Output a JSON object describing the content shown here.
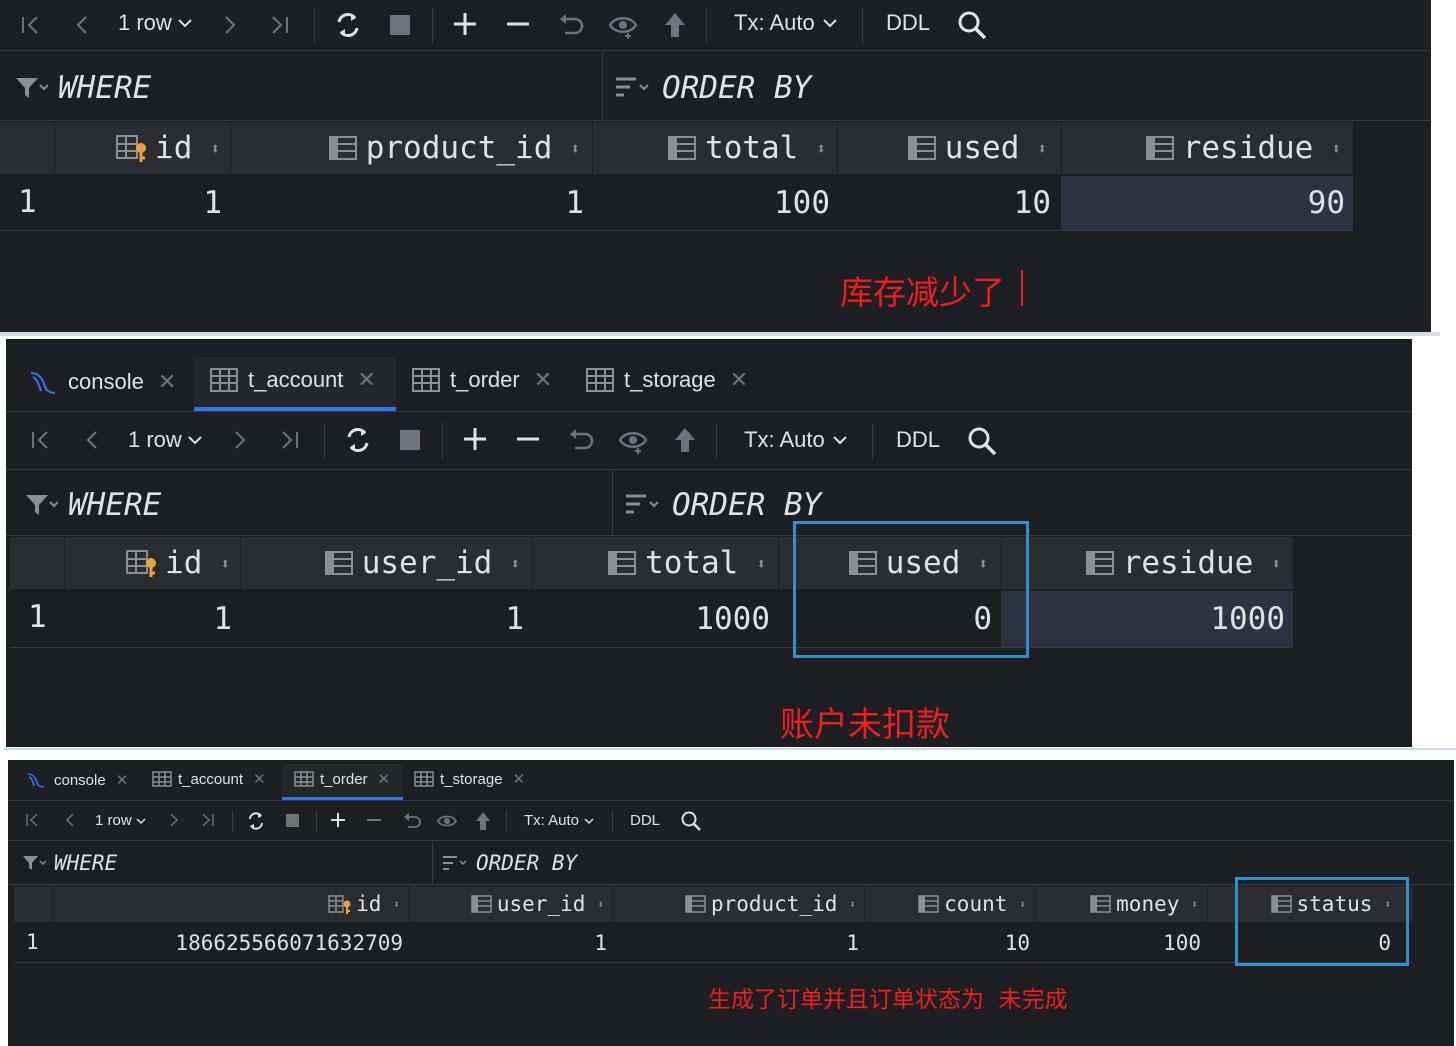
{
  "toolbar": {
    "row_count": "1 row",
    "tx": "Tx: Auto",
    "ddl": "DDL"
  },
  "filters": {
    "where": "WHERE",
    "order_by": "ORDER BY"
  },
  "tabs": [
    {
      "label": "console",
      "active": false
    },
    {
      "label": "t_account",
      "active": true
    },
    {
      "label": "t_order",
      "active": false
    },
    {
      "label": "t_storage",
      "active": false
    }
  ],
  "tabs3": [
    {
      "label": "console",
      "active": false
    },
    {
      "label": "t_account",
      "active": false
    },
    {
      "label": "t_order",
      "active": true
    },
    {
      "label": "t_storage",
      "active": false
    }
  ],
  "storage": {
    "columns": [
      "id",
      "product_id",
      "total",
      "used",
      "residue"
    ],
    "rows": [
      {
        "num": "1",
        "values": [
          "1",
          "1",
          "100",
          "10",
          "90"
        ]
      }
    ],
    "annotation": "库存减少了"
  },
  "account": {
    "columns": [
      "id",
      "user_id",
      "total",
      "used",
      "residue"
    ],
    "rows": [
      {
        "num": "1",
        "values": [
          "1",
          "1",
          "1000",
          "0",
          "1000"
        ]
      }
    ],
    "annotation": "账户未扣款"
  },
  "order": {
    "columns": [
      "id",
      "user_id",
      "product_id",
      "count",
      "money",
      "status"
    ],
    "rows": [
      {
        "num": "1",
        "values": [
          "186625566071632709",
          "1",
          "1",
          "10",
          "100",
          "0"
        ]
      }
    ],
    "annotation": "生成了订单并且订单状态为  未完成"
  },
  "colors": {
    "background": "#1e1f22",
    "header": "#2b2d30",
    "selected": "#2e3242",
    "accent": "#3574f0",
    "annotation": "#f01e1e",
    "highlight_box": "#2f8fd1"
  },
  "icons": [
    "first-page-icon",
    "prev-page-icon",
    "chevron-down-icon",
    "next-page-icon",
    "last-page-icon",
    "refresh-icon",
    "stop-icon",
    "add-row-icon",
    "remove-row-icon",
    "revert-icon",
    "preview-icon",
    "submit-icon",
    "search-icon",
    "filter-icon",
    "sort-icon",
    "key-column-icon",
    "column-icon",
    "close-icon",
    "mysql-icon",
    "table-icon"
  ]
}
